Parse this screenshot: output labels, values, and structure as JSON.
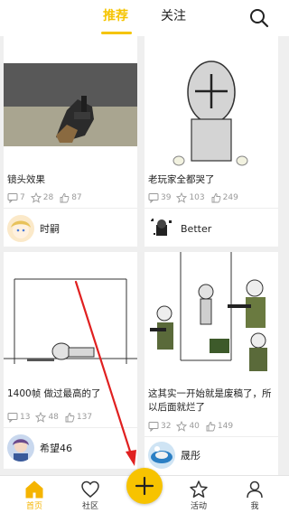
{
  "header": {
    "tabs": [
      "推荐",
      "关注"
    ],
    "active_tab": "推荐",
    "accent_color": "#f5c400"
  },
  "feed": {
    "cards": [
      {
        "caption": "镜头效果",
        "comments": "7",
        "likes": "28",
        "shares": "87",
        "author": "时嗣"
      },
      {
        "caption": "老玩家全都哭了",
        "comments": "39",
        "likes": "103",
        "shares": "249",
        "author": "Better"
      },
      {
        "caption": "1400帧  做过最高的了",
        "comments": "13",
        "likes": "48",
        "shares": "137",
        "author": "希望46"
      },
      {
        "caption": "这其实一开始就是废稿了，所以后面就烂了",
        "comments": "32",
        "likes": "40",
        "shares": "149",
        "author": "晟彤"
      }
    ]
  },
  "bottom_nav": {
    "items": [
      {
        "label": "首页",
        "icon": "home-icon",
        "active": true
      },
      {
        "label": "社区",
        "icon": "heart-icon",
        "active": false
      },
      {
        "label": "活动",
        "icon": "star-icon",
        "active": false
      },
      {
        "label": "我",
        "icon": "user-icon",
        "active": false
      }
    ],
    "fab_icon": "plus-icon",
    "fab_color": "#f7c300"
  }
}
